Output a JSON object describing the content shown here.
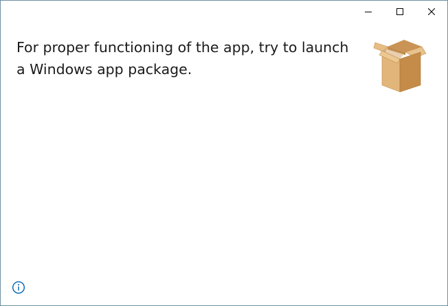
{
  "window": {
    "controls": {
      "minimize_icon": "minimize-icon",
      "maximize_icon": "maximize-icon",
      "close_icon": "close-icon"
    }
  },
  "main": {
    "message_line_1": "For proper functioning of the app, try to launch",
    "message_line_2": "a Windows app package.",
    "illustration_icon": "open-box-icon"
  },
  "footer": {
    "info_icon": "info-icon"
  },
  "colors": {
    "text": "#1a1a1a",
    "info_accent": "#0063b1",
    "box_light": "#e3b77c",
    "box_mid": "#d4a062",
    "box_dark": "#b98340"
  }
}
